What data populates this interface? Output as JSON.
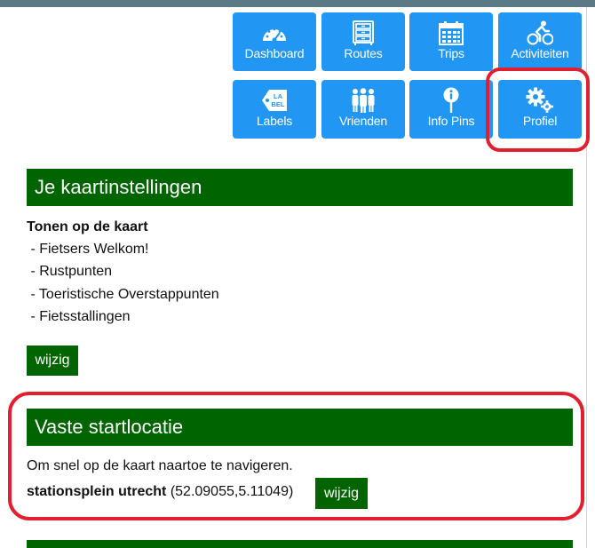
{
  "colors": {
    "tile_blue": "#2196f3",
    "section_green": "#006400",
    "highlight_red": "#e0202e",
    "top_bar": "#5b7a86"
  },
  "nav": {
    "tiles": [
      {
        "label": "Dashboard",
        "icon": "dashboard-gauge-icon"
      },
      {
        "label": "Routes",
        "icon": "routes-cabinet-icon"
      },
      {
        "label": "Trips",
        "icon": "calendar-icon"
      },
      {
        "label": "Activiteiten",
        "icon": "cyclist-icon"
      },
      {
        "label": "Labels",
        "icon": "label-tag-icon"
      },
      {
        "label": "Vrienden",
        "icon": "friends-icon"
      },
      {
        "label": "Info Pins",
        "icon": "info-pin-icon"
      },
      {
        "label": "Profiel",
        "icon": "gears-icon"
      }
    ],
    "label_badge": [
      "LA",
      "BEL"
    ]
  },
  "map_settings": {
    "title": "Je kaartinstellingen",
    "subtitle": "Tonen op de kaart",
    "items": [
      " - Fietsers Welkom!",
      " - Rustpunten",
      " - Toeristische Overstappunten",
      " - Fietsstallingen"
    ],
    "edit_label": "wijzig"
  },
  "start_location": {
    "title": "Vaste startlocatie",
    "description": "Om snel op de kaart naartoe te navigeren.",
    "name": "stationsplein utrecht",
    "coords": "(52.09055,5.11049)",
    "edit_label": "wijzig"
  }
}
